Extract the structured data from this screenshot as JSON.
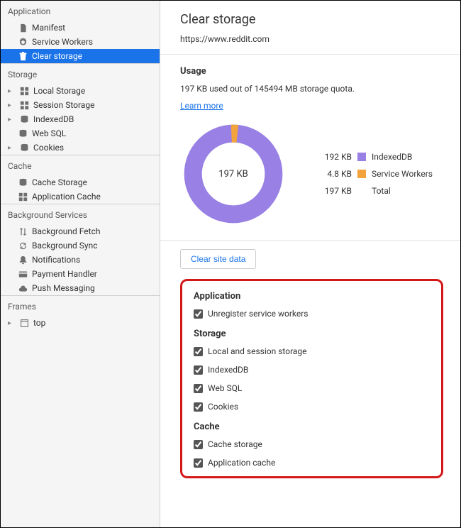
{
  "sidebar": {
    "groups": [
      {
        "title": "Application",
        "items": [
          {
            "icon": "file",
            "label": "Manifest",
            "arrow": false,
            "selected": false
          },
          {
            "icon": "gear",
            "label": "Service Workers",
            "arrow": false,
            "selected": false
          },
          {
            "icon": "trash",
            "label": "Clear storage",
            "arrow": false,
            "selected": true
          }
        ]
      },
      {
        "title": "Storage",
        "items": [
          {
            "icon": "grid",
            "label": "Local Storage",
            "arrow": true,
            "selected": false
          },
          {
            "icon": "grid",
            "label": "Session Storage",
            "arrow": true,
            "selected": false
          },
          {
            "icon": "db",
            "label": "IndexedDB",
            "arrow": true,
            "selected": false
          },
          {
            "icon": "db",
            "label": "Web SQL",
            "arrow": false,
            "selected": false
          },
          {
            "icon": "db",
            "label": "Cookies",
            "arrow": true,
            "selected": false
          }
        ]
      },
      {
        "title": "Cache",
        "items": [
          {
            "icon": "db",
            "label": "Cache Storage",
            "arrow": false,
            "selected": false
          },
          {
            "icon": "grid",
            "label": "Application Cache",
            "arrow": false,
            "selected": false
          }
        ]
      },
      {
        "title": "Background Services",
        "items": [
          {
            "icon": "updown",
            "label": "Background Fetch",
            "arrow": false,
            "selected": false
          },
          {
            "icon": "sync",
            "label": "Background Sync",
            "arrow": false,
            "selected": false
          },
          {
            "icon": "bell",
            "label": "Notifications",
            "arrow": false,
            "selected": false
          },
          {
            "icon": "card",
            "label": "Payment Handler",
            "arrow": false,
            "selected": false
          },
          {
            "icon": "cloud",
            "label": "Push Messaging",
            "arrow": false,
            "selected": false
          }
        ]
      },
      {
        "title": "Frames",
        "items": [
          {
            "icon": "window",
            "label": "top",
            "arrow": true,
            "selected": false
          }
        ]
      }
    ]
  },
  "main": {
    "title": "Clear storage",
    "url": "https://www.reddit.com",
    "usage": {
      "title": "Usage",
      "text": "197 KB used out of 145494 MB storage quota.",
      "learn_more": "Learn more",
      "total_label": "197 KB",
      "legend": [
        {
          "size": "192 KB",
          "color": "purple",
          "name": "IndexedDB"
        },
        {
          "size": "4.8 KB",
          "color": "orange",
          "name": "Service Workers"
        },
        {
          "size": "197 KB",
          "color": "none",
          "name": "Total"
        }
      ]
    },
    "clear_button": "Clear site data",
    "options": [
      {
        "title": "Application",
        "items": [
          {
            "label": "Unregister service workers",
            "checked": true
          }
        ]
      },
      {
        "title": "Storage",
        "items": [
          {
            "label": "Local and session storage",
            "checked": true
          },
          {
            "label": "IndexedDB",
            "checked": true
          },
          {
            "label": "Web SQL",
            "checked": true
          },
          {
            "label": "Cookies",
            "checked": true
          }
        ]
      },
      {
        "title": "Cache",
        "items": [
          {
            "label": "Cache storage",
            "checked": true
          },
          {
            "label": "Application cache",
            "checked": true
          }
        ]
      }
    ]
  },
  "chart_data": {
    "type": "pie",
    "title": "",
    "series": [
      {
        "name": "IndexedDB",
        "value": 192,
        "unit": "KB",
        "color": "#9880e5"
      },
      {
        "name": "Service Workers",
        "value": 4.8,
        "unit": "KB",
        "color": "#f2a33c"
      }
    ],
    "total": {
      "value": 197,
      "unit": "KB"
    },
    "donut": true
  }
}
